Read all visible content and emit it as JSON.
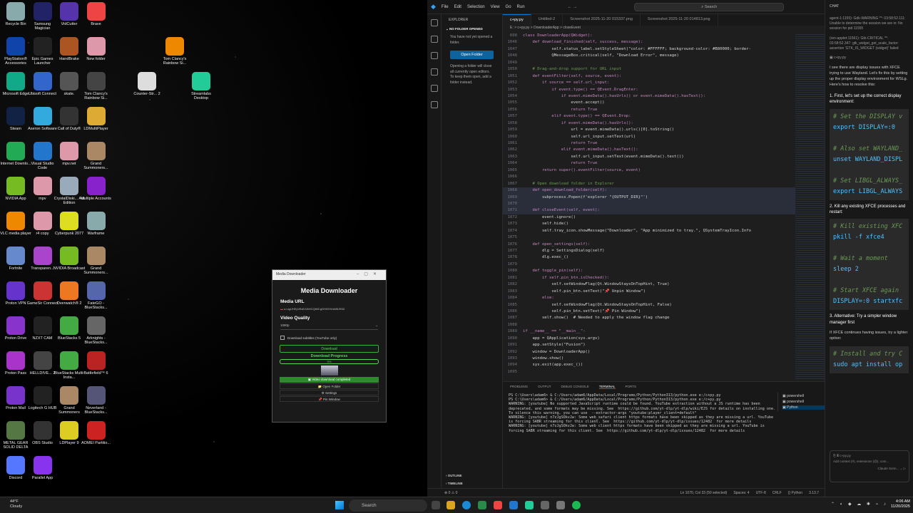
{
  "desktop": {
    "icons": [
      {
        "label": "Recycle Bin",
        "color": "#8aa"
      },
      {
        "label": "Samsung Magician",
        "color": "#226"
      },
      {
        "label": "VidCutter",
        "color": "#53a"
      },
      {
        "label": "Brave",
        "color": "#e44"
      },
      {
        "label": "PlayStation® Accessories",
        "color": "#14a"
      },
      {
        "label": "Epic Games Launcher",
        "color": "#222"
      },
      {
        "label": "HandBrake",
        "color": "#a52"
      },
      {
        "label": "New folder",
        "color": "#d9a"
      },
      {
        "label": "Microsoft Edge",
        "color": "#1a8"
      },
      {
        "label": "Ubisoft Connect",
        "color": "#36c"
      },
      {
        "label": "skate.",
        "color": "#555"
      },
      {
        "label": "Tom Clancy's Rainbow Si...",
        "color": "#444"
      },
      {
        "label": "Steam",
        "color": "#124"
      },
      {
        "label": "Aseron Software",
        "color": "#3ad"
      },
      {
        "label": "Call of Duty®",
        "color": "#333"
      },
      {
        "label": "LDMultiPlayer",
        "color": "#da3"
      },
      {
        "label": "Internet Downlo...",
        "color": "#2a5"
      },
      {
        "label": "Visual Studio Code",
        "color": "#27c"
      },
      {
        "label": "mpv.net",
        "color": "#d9a"
      },
      {
        "label": "Grand Summoners...",
        "color": "#a86"
      },
      {
        "label": "NVIDIA App",
        "color": "#7b2"
      },
      {
        "label": "mpv",
        "color": "#d9a"
      },
      {
        "label": "CrystalDiski... Aoi Edition",
        "color": "#9ab"
      },
      {
        "label": "Multiple Accounts",
        "color": "#82c"
      },
      {
        "label": "VLC media player",
        "color": "#e80"
      },
      {
        "label": "r4 copy",
        "color": "#d9a"
      },
      {
        "label": "Cyberpunk 2077",
        "color": "#dd2"
      },
      {
        "label": "Warframe",
        "color": "#8aa"
      },
      {
        "label": "Fortnite",
        "color": "#68c"
      },
      {
        "label": "Transparen...",
        "color": "#a4c"
      },
      {
        "label": "NVIDIA Broadcast",
        "color": "#7b2"
      },
      {
        "label": "Grand Summoners...",
        "color": "#a86"
      },
      {
        "label": "Proton VPN",
        "color": "#63c"
      },
      {
        "label": "GameSir Connect",
        "color": "#c33"
      },
      {
        "label": "Overwatch® 2",
        "color": "#e72"
      },
      {
        "label": "FateGO - BlueStacks...",
        "color": "#56a"
      },
      {
        "label": "Proton Drive",
        "color": "#83c"
      },
      {
        "label": "NZXT CAM",
        "color": "#222"
      },
      {
        "label": "BlueStacks 5",
        "color": "#4a4"
      },
      {
        "label": "Arknights - BlueStacks...",
        "color": "#666"
      },
      {
        "label": "Proton Pass",
        "color": "#a3c"
      },
      {
        "label": "HELLDIVE... 2",
        "color": "#444"
      },
      {
        "label": "BlueStacks Multi-Insta...",
        "color": "#4a4"
      },
      {
        "label": "Battlefield™ 6",
        "color": "#b22"
      },
      {
        "label": "Proton Mail",
        "color": "#73c"
      },
      {
        "label": "Logitech G HUB",
        "color": "#222"
      },
      {
        "label": "Grand Summoners",
        "color": "#a86"
      },
      {
        "label": "Neverland - BlueStacks...",
        "color": "#557"
      },
      {
        "label": "METAL GEAR SOLID DELTA",
        "color": "#574"
      },
      {
        "label": "OBS Studio",
        "color": "#333"
      },
      {
        "label": "LDPlayer 9",
        "color": "#dc2"
      },
      {
        "label": "AOMEI Partitio...",
        "color": "#c22"
      },
      {
        "label": "Discord",
        "color": "#57f"
      },
      {
        "label": "Parallel App",
        "color": "#83e"
      }
    ],
    "extra_icons": [
      {
        "label": "Tom Clancy's Rainbow Si...",
        "color": "#e80"
      },
      {
        "label": "Counter-Str... 2",
        "color": "#ddd"
      },
      {
        "label": "Streamlabs Desktop",
        "color": "#2c9"
      }
    ]
  },
  "downloader": {
    "window_title": "Media Downloader",
    "heading": "Media Downloader",
    "url_label": "Media URL",
    "url_value": "s=ugUHEyVBdVU6HCQiMCgGHiGHVsM6J93D",
    "quality_label": "Video Quality",
    "quality_value": "1080p",
    "subtitles_label": "Download subtitles (YouTube only)",
    "download_btn": "Download",
    "progress_label": "Download Progress",
    "progress_text": "0%",
    "progress": 0,
    "status": "Video download completed",
    "open_folder": "Open Folder",
    "settings": "Settings",
    "pin": "Pin Window"
  },
  "vscode": {
    "menu": [
      "File",
      "Edit",
      "Selection",
      "View",
      "Go",
      "Run"
    ],
    "search_placeholder": "Search",
    "explorer_title": "EXPLORER",
    "no_folder": "NO FOLDER OPENED",
    "no_folder_msg": "You have not yet opened a folder.",
    "open_folder_btn": "Open Folder",
    "close_msg": "Opening a folder will close all currently open editors. To keep them open, add a folder instead.",
    "outline": "OUTLINE",
    "timeline": "TIMELINE",
    "tabs": [
      "c+py.py",
      "Untitled-2",
      "Screenshot 2025-11-20 015337.png",
      "Screenshot 2025-11-20 014813.png"
    ],
    "breadcrumb": "E: > c+py.py > DownloaderApp > closeEvent",
    "code_lines": [
      {
        "n": "608",
        "t": "class DownloaderApp(QWidget):"
      },
      {
        "n": "1046",
        "t": "    def download_finished(self, success, message):"
      },
      {
        "n": "1047",
        "t": "            self.status_label.setStyleSheet(\"color: #FFFFFF; background-color: #B80000; border-"
      },
      {
        "n": "1048",
        "t": "            QMessageBox.critical(self, \"Download Error\", message)"
      },
      {
        "n": "1049",
        "t": ""
      },
      {
        "n": "1050",
        "t": "    # Drag-and-drop support for URL input"
      },
      {
        "n": "1051",
        "t": "    def eventFilter(self, source, event):"
      },
      {
        "n": "1052",
        "t": "        if source == self.url_input:"
      },
      {
        "n": "1053",
        "t": "            if event.type() == QEvent.DragEnter:"
      },
      {
        "n": "1054",
        "t": "                if event.mimeData().hasUrls() or event.mimeData().hasText():"
      },
      {
        "n": "1055",
        "t": "                    event.accept()"
      },
      {
        "n": "1056",
        "t": "                    return True"
      },
      {
        "n": "1057",
        "t": "            elif event.type() == QEvent.Drop:"
      },
      {
        "n": "1058",
        "t": "                if event.mimeData().hasUrls():"
      },
      {
        "n": "1059",
        "t": "                    url = event.mimeData().urls()[0].toString()"
      },
      {
        "n": "1060",
        "t": "                    self.url_input.setText(url)"
      },
      {
        "n": "1061",
        "t": "                    return True"
      },
      {
        "n": "1062",
        "t": "                elif event.mimeData().hasText():"
      },
      {
        "n": "1063",
        "t": "                    self.url_input.setText(event.mimeData().text())"
      },
      {
        "n": "1064",
        "t": "                    return True"
      },
      {
        "n": "1065",
        "t": "        return super().eventFilter(source, event)"
      },
      {
        "n": "1066",
        "t": ""
      },
      {
        "n": "1067",
        "t": "    # Open download folder in Explorer"
      },
      {
        "n": "1068",
        "t": "    def open_download_folder(self):"
      },
      {
        "n": "1069",
        "t": "        subprocess.Popen(f'explorer \"{OUTPUT_DIR}\"')"
      },
      {
        "n": "1070",
        "t": ""
      },
      {
        "n": "1071",
        "t": "    def closeEvent(self, event):"
      },
      {
        "n": "1072",
        "t": "        event.ignore()"
      },
      {
        "n": "1073",
        "t": "        self.hide()"
      },
      {
        "n": "1074",
        "t": "        self.tray_icon.showMessage(\"Downloader\", \"App minimized to tray.\", QSystemTrayIcon.Info"
      },
      {
        "n": "1075",
        "t": ""
      },
      {
        "n": "1076",
        "t": "    def open_settings(self):"
      },
      {
        "n": "1077",
        "t": "        dlg = SettingsDialog(self)"
      },
      {
        "n": "1078",
        "t": "        dlg.exec_()"
      },
      {
        "n": "1079",
        "t": ""
      },
      {
        "n": "1080",
        "t": "    def toggle_pin(self):"
      },
      {
        "n": "1081",
        "t": "        if self.pin_btn.isChecked():"
      },
      {
        "n": "1082",
        "t": "            self.setWindowFlag(Qt.WindowStaysOnTopHint, True)"
      },
      {
        "n": "1083",
        "t": "            self.pin_btn.setText(\"📌 Unpin Window\")"
      },
      {
        "n": "1084",
        "t": "        else:"
      },
      {
        "n": "1085",
        "t": "            self.setWindowFlag(Qt.WindowStaysOnTopHint, False)"
      },
      {
        "n": "1086",
        "t": "            self.pin_btn.setText(\"📌 Pin Window\")"
      },
      {
        "n": "1087",
        "t": "        self.show()  # Needed to apply the window flag change"
      },
      {
        "n": "1088",
        "t": ""
      },
      {
        "n": "1089",
        "t": "if __name__ == \"__main__\":"
      },
      {
        "n": "1090",
        "t": "    app = QApplication(sys.argv)"
      },
      {
        "n": "1091",
        "t": "    app.setStyle(\"Fusion\")"
      },
      {
        "n": "1092",
        "t": "    window = DownloaderApp()"
      },
      {
        "n": "1093",
        "t": "    window.show()"
      },
      {
        "n": "1094",
        "t": "    sys.exit(app.exec_())"
      },
      {
        "n": "1095",
        "t": ""
      }
    ],
    "panel_tabs": [
      "PROBLEMS",
      "OUTPUT",
      "DEBUG CONSOLE",
      "TERMINAL",
      "PORTS"
    ],
    "terminal": "PS C:\\Users\\adam6> & C:/Users/adam6/AppData/Local/Programs/Python/Python313/python.exe e:/c+py.py\nPS C:\\Users\\adam6> & C:/Users/adam6/AppData/Local/Programs/Python/Python313/python.exe e:/c+py.py\nWARNING: [youtube] No supported JavaScript runtime could be found. YouTube extraction without a JS runtime has been deprecated, and some formats may be missing. See  https://github.com/yt-dlp/yt-dlp/wiki/EJS for details on installing one. To silence this warning, you can use  --extractor-args \"youtube:player_client=default\"\nWARNING: [youtube] n7zJgSOkvJw: Some web_safari client https formats have been skipped as they are missing a url. YouTube is forcing SABR streaming for this client. See  https://github.com/yt-dlp/yt-dlp/issues/12482  for more details\nWARNING: [youtube] n7zJgSOkvJw: Some web client https formats have been skipped as they are missing a url. YouTube is forcing SABR streaming for this client. See  https://github.com/yt-dlp/yt-dlp/issues/12482  for more details",
    "terminals": [
      "powershell",
      "powershell",
      "Python"
    ],
    "status_left": "⊗ 0 ⚠ 0",
    "status_right": [
      "Ln 1070, Col 33 (50 selected)",
      "Spaces: 4",
      "UTF-8",
      "CRLF",
      "{} Python",
      "3.13.7"
    ]
  },
  "chat": {
    "title": "CHAT",
    "log": "agent-1:1155): Gdk-WARNING **: 03:58:52.111: Unable to determine the session we are in: No session for pid 11555\n\n(ren-applet:11561): Gtk-CRITICAL **: 03:58:52.347: gtk_widget_get_scale_factor: assertion 'GTK_IS_WIDGET (widget)' failed",
    "file_ref": "c+py.py",
    "intro": "I see there are display issues with XFCE trying to use Wayland. Let's fix this by setting up the proper display environment for WSLg. Here's how to resolve this:",
    "step1": "1. First, let's set up the correct display environment:",
    "code1": [
      {
        "c": "# Set the DISPLAY v"
      },
      {
        "k": "export DISPLAY=:0"
      },
      {
        "c": ""
      },
      {
        "c": "# Also set WAYLAND_"
      },
      {
        "k": "unset WAYLAND_DISPL"
      },
      {
        "c": ""
      },
      {
        "c": "# Set LIBGL_ALWAYS_"
      },
      {
        "k": "export LIBGL_ALWAYS"
      }
    ],
    "step2": "2. Kill any existing XFCE processes and restart:",
    "code2": [
      {
        "c": "# Kill existing XFC"
      },
      {
        "k": "pkill -f xfce4"
      },
      {
        "c": ""
      },
      {
        "c": "# Wait a moment"
      },
      {
        "k": "sleep 2"
      },
      {
        "c": ""
      },
      {
        "c": "# Start XFCE again"
      },
      {
        "k": "DISPLAY=:0 startxfc"
      }
    ],
    "step3": "3. Alternative: Try a simpler window manager first",
    "step3b": "If XFCE continues having issues, try a lighter option:",
    "code3": [
      {
        "c": "# Install and try C"
      },
      {
        "k": "sudo apt install op"
      }
    ],
    "input_placeholder": "Add context (#), extensions (@), com...",
    "model": "Claude Sonn..."
  },
  "taskbar": {
    "temp": "44°F",
    "weather": "Cloudy",
    "search": "Search",
    "time": "4:06 AM",
    "date": "11/20/2025"
  }
}
